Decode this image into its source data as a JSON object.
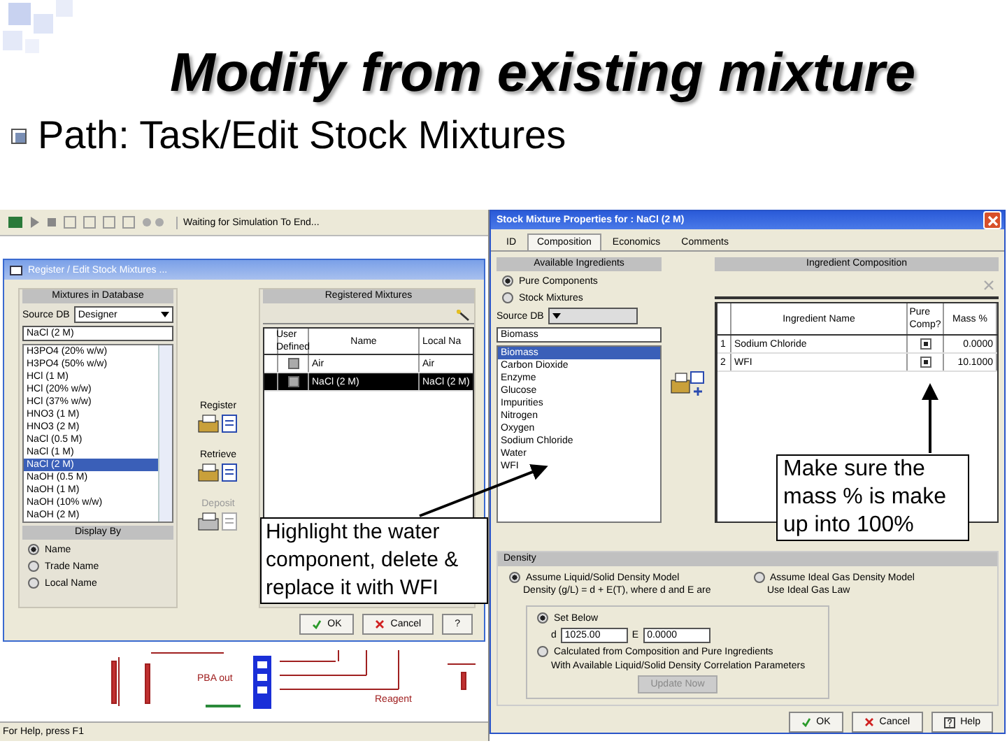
{
  "slide": {
    "title": "Modify from existing mixture",
    "bullet": "Path: Task/Edit Stock Mixtures"
  },
  "app": {
    "toolbar_text": "Waiting for Simulation To End...",
    "status_bar": "For Help, press F1",
    "diagram_labels": [
      "PBA out",
      "Reagent"
    ]
  },
  "register_dialog": {
    "title": "Register / Edit Stock Mixtures ...",
    "db_panel": {
      "heading": "Mixtures in Database",
      "source_label": "Source DB",
      "source_value": "Designer",
      "search_value": "NaCl (2 M)",
      "items": [
        {
          "label": "H3PO4 (20% w/w)",
          "selected": false
        },
        {
          "label": "H3PO4 (50% w/w)",
          "selected": false
        },
        {
          "label": "HCl (1 M)",
          "selected": false
        },
        {
          "label": "HCl (20% w/w)",
          "selected": false
        },
        {
          "label": "HCl (37% w/w)",
          "selected": false
        },
        {
          "label": "HNO3 (1 M)",
          "selected": false
        },
        {
          "label": "HNO3 (2 M)",
          "selected": false
        },
        {
          "label": "NaCl (0.5 M)",
          "selected": false
        },
        {
          "label": "NaCl (1 M)",
          "selected": false
        },
        {
          "label": "NaCl (2 M)",
          "selected": true
        },
        {
          "label": "NaOH (0.5 M)",
          "selected": false
        },
        {
          "label": "NaOH (1 M)",
          "selected": false
        },
        {
          "label": "NaOH (10% w/w)",
          "selected": false
        },
        {
          "label": "NaOH (2 M)",
          "selected": false
        }
      ]
    },
    "display_by": {
      "heading": "Display By",
      "options": [
        {
          "label": "Name",
          "selected": true
        },
        {
          "label": "Trade Name",
          "selected": false
        },
        {
          "label": "Local Name",
          "selected": false
        }
      ]
    },
    "actions": [
      {
        "label": "Register",
        "disabled": false
      },
      {
        "label": "Retrieve",
        "disabled": false
      },
      {
        "label": "Deposit",
        "disabled": true
      }
    ],
    "registered": {
      "heading": "Registered Mixtures",
      "columns": [
        "User Defined",
        "Name",
        "Local Na"
      ],
      "rows": [
        {
          "user_defined": false,
          "name": "Air",
          "local_name": "Air",
          "selected": false
        },
        {
          "user_defined": false,
          "name": "NaCl (2 M)",
          "local_name": "NaCl (2 M)",
          "selected": true
        }
      ]
    },
    "buttons": [
      {
        "label": "OK",
        "kind": "ok"
      },
      {
        "label": "Cancel",
        "kind": "cancel"
      },
      {
        "label": "?",
        "kind": "help"
      }
    ]
  },
  "properties_dialog": {
    "title": "Stock Mixture Properties for : NaCl (2 M)",
    "tabs": [
      {
        "label": "ID",
        "selected": false
      },
      {
        "label": "Composition",
        "selected": true
      },
      {
        "label": "Economics",
        "selected": false
      },
      {
        "label": "Comments",
        "selected": false
      }
    ],
    "available": {
      "heading": "Available Ingredients",
      "options": [
        {
          "label": "Pure Components",
          "selected": true
        },
        {
          "label": "Stock Mixtures",
          "selected": false
        }
      ],
      "source_label": "Source DB",
      "search_value": "Biomass",
      "items": [
        {
          "label": "Biomass",
          "selected": true
        },
        {
          "label": "Carbon Dioxide",
          "selected": false
        },
        {
          "label": "Enzyme",
          "selected": false
        },
        {
          "label": "Glucose",
          "selected": false
        },
        {
          "label": "Impurities",
          "selected": false
        },
        {
          "label": "Nitrogen",
          "selected": false
        },
        {
          "label": "Oxygen",
          "selected": false
        },
        {
          "label": "Sodium Chloride",
          "selected": false
        },
        {
          "label": "Water",
          "selected": false
        },
        {
          "label": "WFI",
          "selected": false
        }
      ]
    },
    "composition": {
      "heading": "Ingredient Composition",
      "columns": [
        "Ingredient Name",
        "Pure Comp?",
        "Mass %"
      ],
      "rows": [
        {
          "index": "1",
          "name": "Sodium Chloride",
          "pure": true,
          "mass": "0.0000"
        },
        {
          "index": "2",
          "name": "WFI",
          "pure": true,
          "mass": "10.1000"
        }
      ]
    },
    "density": {
      "heading": "Density",
      "liquid_option": {
        "label": "Assume Liquid/Solid Density Model",
        "selected": true
      },
      "liquid_note": "Density (g/L) = d + E(T), where d and E are",
      "gas_option": {
        "label": "Assume Ideal Gas Density Model",
        "selected": false
      },
      "gas_note": "Use Ideal Gas Law",
      "set_below": {
        "label": "Set Below",
        "selected": true
      },
      "d_label": "d",
      "d_value": "1025.00",
      "e_label": "E",
      "e_value": "0.0000",
      "calculated": {
        "label": "Calculated from Composition and Pure Ingredients",
        "selected": false
      },
      "calculated_note": "With Available Liquid/Solid Density Correlation Parameters",
      "update_button": {
        "label": "Update Now",
        "disabled": true
      }
    },
    "buttons": [
      {
        "label": "OK",
        "kind": "ok"
      },
      {
        "label": "Cancel",
        "kind": "cancel"
      },
      {
        "label": "Help",
        "kind": "help"
      }
    ]
  },
  "callouts": [
    {
      "text": "Highlight the water component, delete & replace it with WFI"
    },
    {
      "text": "Make sure the mass % is make up into 100%"
    }
  ]
}
